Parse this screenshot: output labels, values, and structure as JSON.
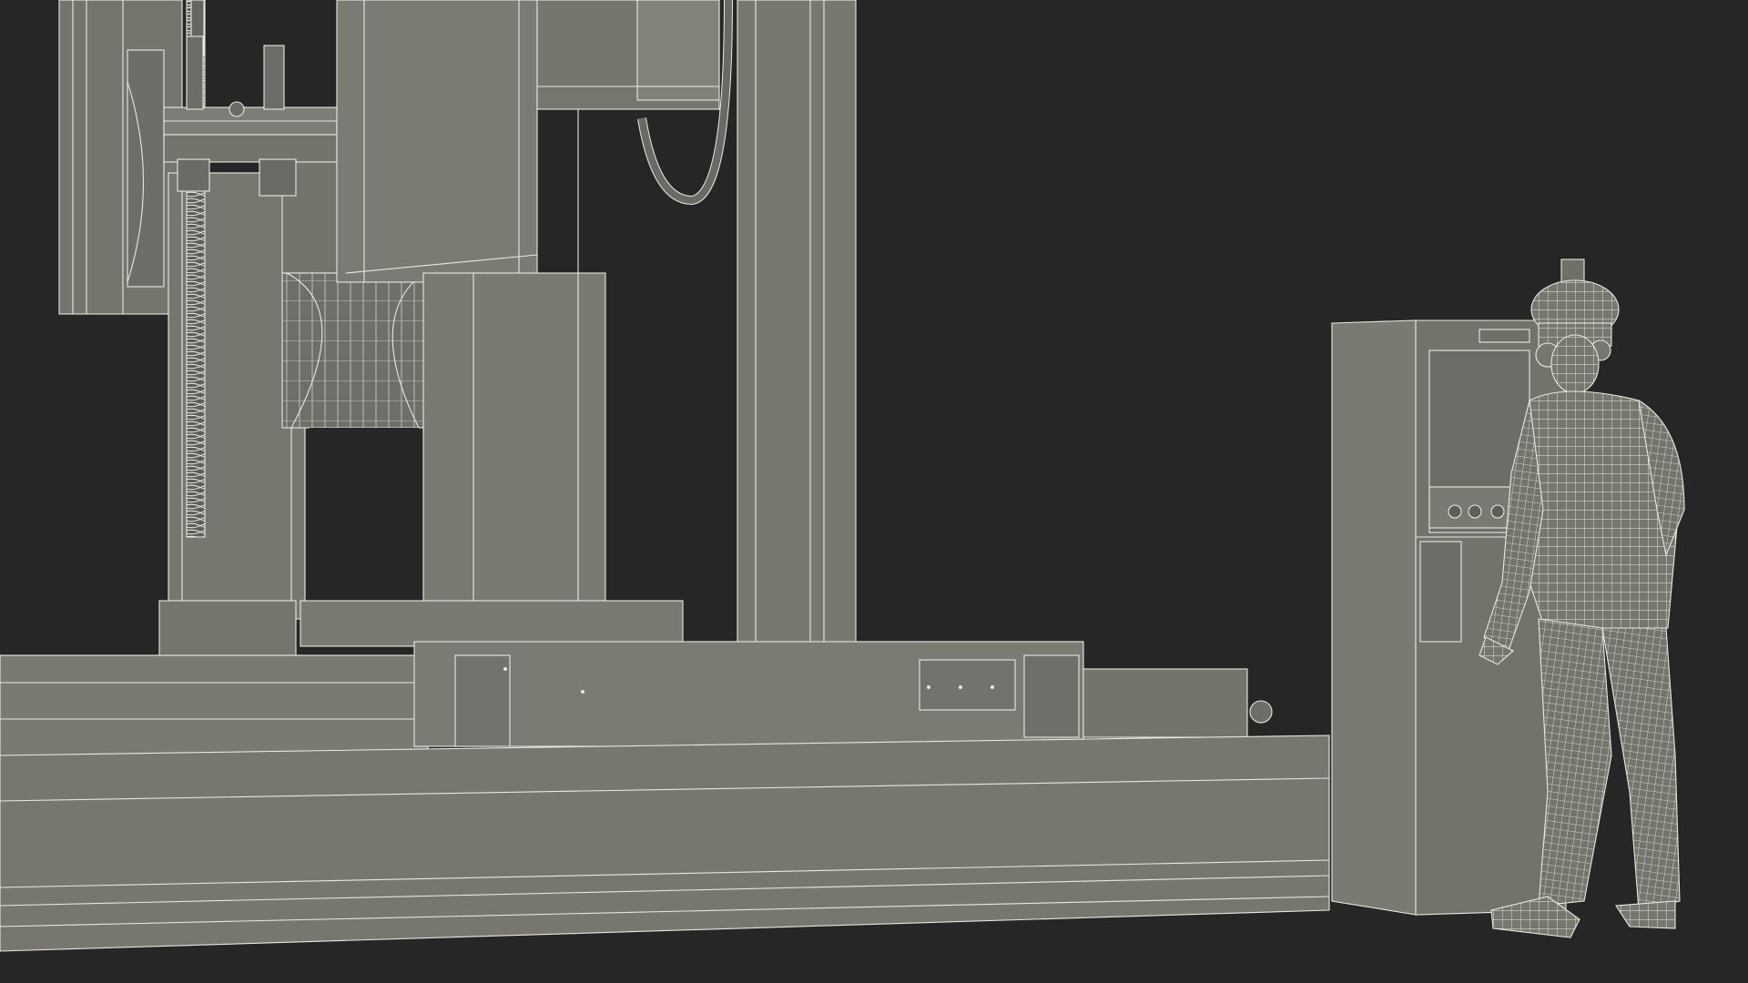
{
  "scene": {
    "background_color": "#262626",
    "model_color": "#7a7a72",
    "wire_color": "#e9e8e1",
    "objects": [
      {
        "name": "gantry-welding-machine"
      },
      {
        "name": "control-cabinet"
      },
      {
        "name": "worker-in-hardhat"
      }
    ]
  }
}
